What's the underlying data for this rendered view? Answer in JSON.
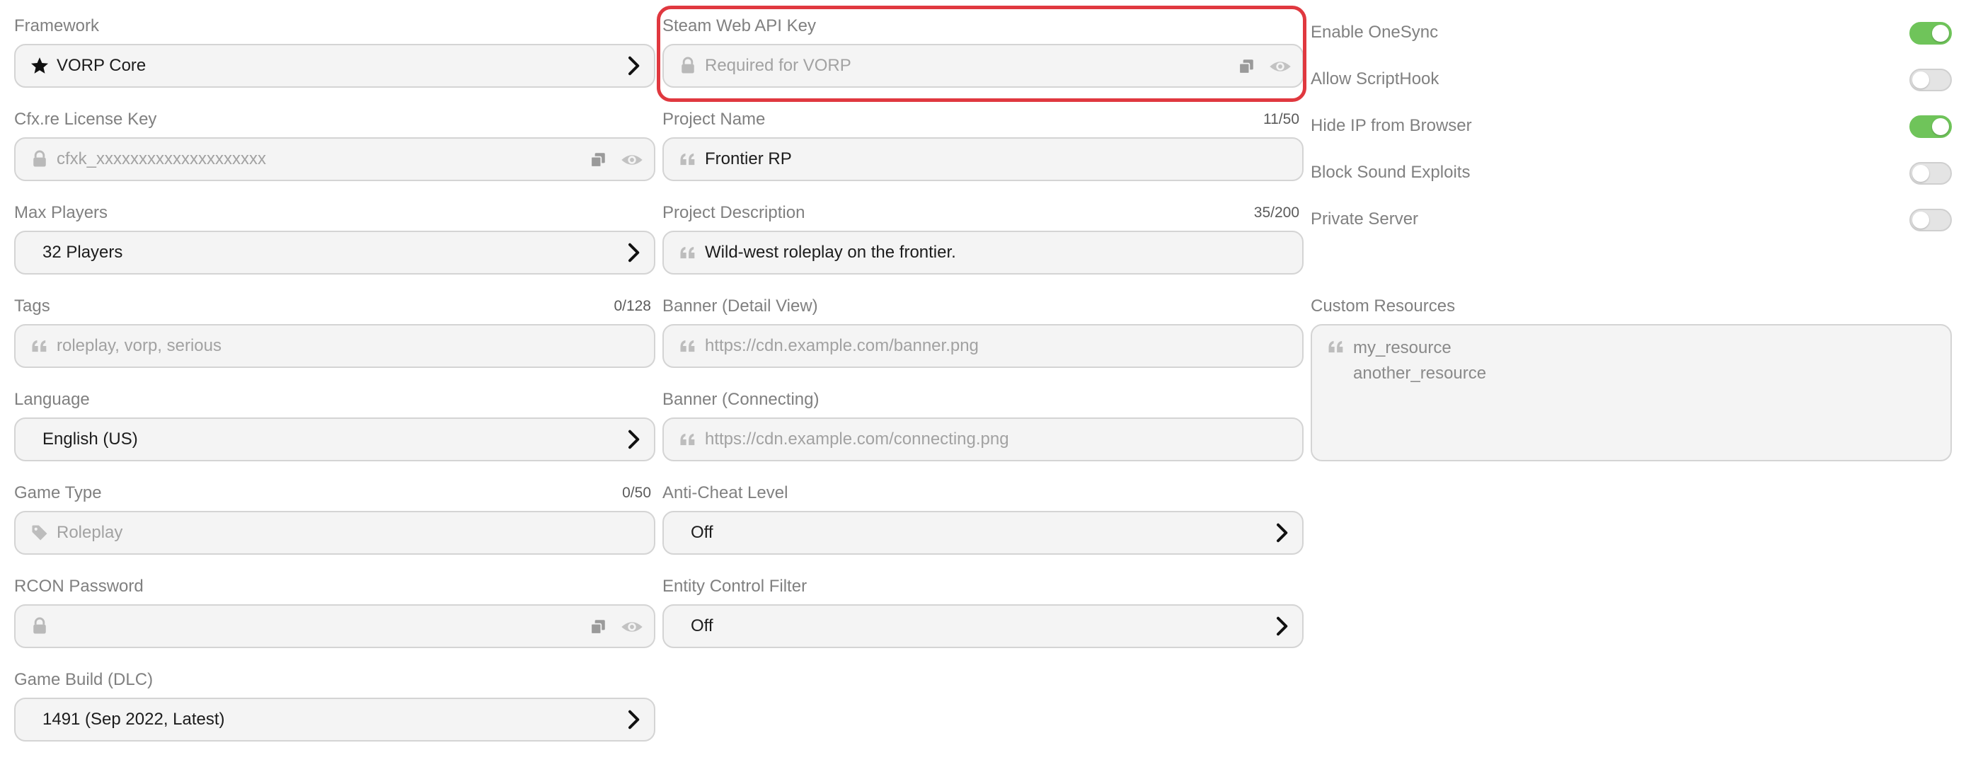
{
  "col1": {
    "framework": {
      "label": "Framework",
      "value": "VORP Core"
    },
    "license": {
      "label": "Cfx.re License Key",
      "placeholder": "cfxk_xxxxxxxxxxxxxxxxxxxx"
    },
    "max_players": {
      "label": "Max Players",
      "value": "32 Players"
    },
    "tags": {
      "label": "Tags",
      "count": "0/128",
      "placeholder": "roleplay, vorp, serious"
    },
    "language": {
      "label": "Language",
      "value": "English (US)"
    },
    "game_type": {
      "label": "Game Type",
      "count": "0/50",
      "placeholder": "Roleplay"
    },
    "rcon": {
      "label": "RCON Password",
      "value": ""
    },
    "game_build": {
      "label": "Game Build (DLC)",
      "value": "1491 (Sep 2022, Latest)"
    }
  },
  "col2": {
    "steam_key": {
      "label": "Steam Web API Key",
      "placeholder": "Required for VORP"
    },
    "project_name": {
      "label": "Project Name",
      "count": "11/50",
      "value": "Frontier RP"
    },
    "project_desc": {
      "label": "Project Description",
      "count": "35/200",
      "value": "Wild-west roleplay on the frontier."
    },
    "banner_detail": {
      "label": "Banner (Detail View)",
      "placeholder": "https://cdn.example.com/banner.png"
    },
    "banner_connecting": {
      "label": "Banner (Connecting)",
      "placeholder": "https://cdn.example.com/connecting.png"
    },
    "anticheat": {
      "label": "Anti-Cheat Level",
      "value": "Off"
    },
    "entity_filter": {
      "label": "Entity Control Filter",
      "value": "Off"
    }
  },
  "col3": {
    "toggles": [
      {
        "label": "Enable OneSync",
        "on": true
      },
      {
        "label": "Allow ScriptHook",
        "on": false
      },
      {
        "label": "Hide IP from Browser",
        "on": true
      },
      {
        "label": "Block Sound Exploits",
        "on": false
      },
      {
        "label": "Private Server",
        "on": false
      }
    ],
    "custom_resources": {
      "label": "Custom Resources",
      "lines": [
        "my_resource",
        "another_resource"
      ]
    }
  },
  "icons": {
    "framework": "star-icon",
    "select": "chevron-right-icon",
    "secret": "lock-icon",
    "copy": "copy-icon",
    "reveal": "eye-icon",
    "text": "quote-icon",
    "tag": "tag-icon"
  },
  "colors": {
    "toggle_on": "#6fc45a",
    "highlight": "#e0383f"
  }
}
